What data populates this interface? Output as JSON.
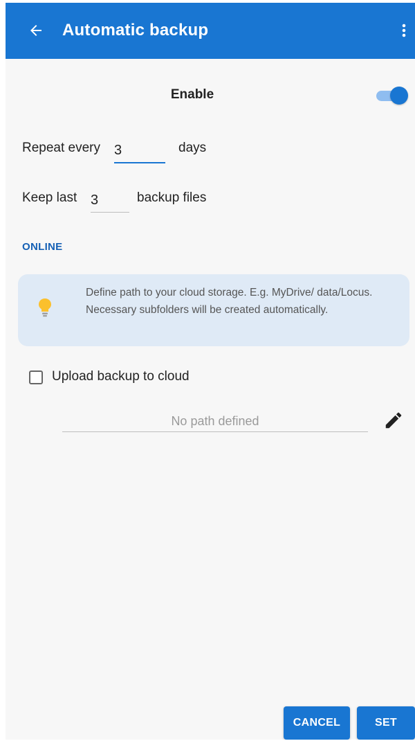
{
  "appbar": {
    "title": "Automatic backup",
    "back_icon": "arrow-left-icon",
    "menu_icon": "more-vertical-icon",
    "color": "#1976d2"
  },
  "enable": {
    "label": "Enable",
    "on": true
  },
  "repeat": {
    "prefix": "Repeat every",
    "value": "3",
    "suffix": "days"
  },
  "keep": {
    "prefix": "Keep last",
    "value": "3",
    "suffix": "backup files"
  },
  "online": {
    "header": "ONLINE",
    "info_icon": "lightbulb-icon",
    "info_text": "Define path to your cloud storage. E.g. MyDrive/ data/Locus. Necessary subfolders will be created automatically.",
    "upload_label": "Upload backup to cloud",
    "upload_checked": false,
    "path_placeholder": "No path defined",
    "edit_icon": "pencil-icon"
  },
  "actions": {
    "cancel_label": "CANCEL",
    "set_label": "SET"
  }
}
